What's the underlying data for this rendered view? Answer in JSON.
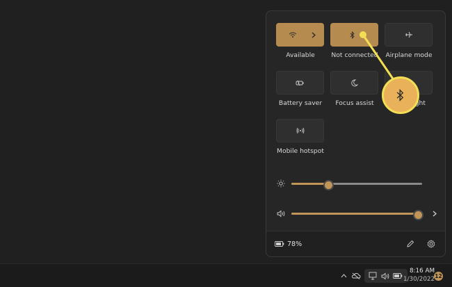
{
  "tiles": [
    {
      "label": "Available",
      "icon": "wifi-icon",
      "active": true
    },
    {
      "label": "Not connected",
      "icon": "bluetooth-icon",
      "active": true
    },
    {
      "label": "Airplane mode",
      "icon": "airplane-icon",
      "active": false
    },
    {
      "label": "Battery saver",
      "icon": "battery-saver-icon",
      "active": false
    },
    {
      "label": "Focus assist",
      "icon": "moon-icon",
      "active": false
    },
    {
      "label": "Night light",
      "icon": "night-light-icon",
      "active": false
    },
    {
      "label": "Mobile hotspot",
      "icon": "hotspot-icon",
      "active": false
    }
  ],
  "brightness": {
    "level": 0.28,
    "icon": "brightness-icon"
  },
  "volume": {
    "level": 0.97,
    "icon": "speaker-icon"
  },
  "footer": {
    "battery_percent": "78%"
  },
  "taskbar": {
    "time": "8:16 AM",
    "date": "1/30/2022",
    "notifications": "12"
  },
  "colors": {
    "accent": "#c19458",
    "callout": "#f3df53"
  }
}
